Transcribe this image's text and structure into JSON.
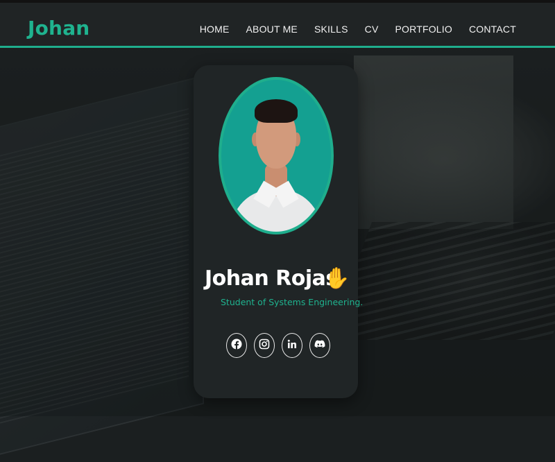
{
  "brand": {
    "logo": "Johan",
    "accent": "#1fae8d"
  },
  "nav": {
    "items": [
      {
        "label": "HOME"
      },
      {
        "label": "ABOUT ME"
      },
      {
        "label": "SKILLS"
      },
      {
        "label": "CV"
      },
      {
        "label": "PORTFOLIO"
      },
      {
        "label": "CONTACT"
      }
    ]
  },
  "profile": {
    "name": "Johan Rojas",
    "emoji": "✋",
    "subtitle": "Student of Systems Engineering.",
    "socials": [
      {
        "icon": "facebook-icon"
      },
      {
        "icon": "instagram-icon"
      },
      {
        "icon": "linkedin-icon"
      },
      {
        "icon": "discord-icon"
      }
    ]
  }
}
